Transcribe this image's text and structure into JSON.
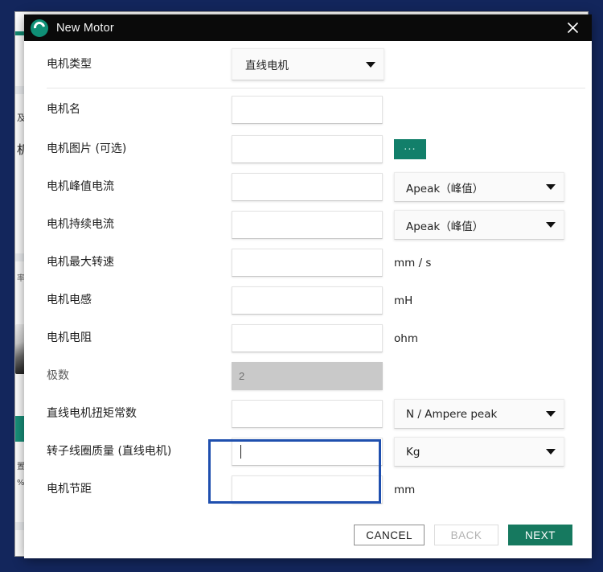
{
  "background_app": {
    "sliver_text_a": "及",
    "sliver_text_b": "机",
    "sliver_text_c": "率",
    "sliver_text_d": "置",
    "sliver_text_e": "%"
  },
  "dialog": {
    "title": "New Motor",
    "logo_icon": "app-logo-icon",
    "close_icon": "close-icon"
  },
  "form": {
    "rows": [
      {
        "label": "电机类型",
        "control": "select",
        "value": "直线电机",
        "trailer": ""
      },
      {
        "label": "电机名",
        "control": "input",
        "value": "",
        "trailer": ""
      },
      {
        "label": "电机图片 (可选)",
        "control": "input",
        "value": "",
        "trailer": "browse",
        "browse_label": "..."
      },
      {
        "label": "电机峰值电流",
        "control": "input",
        "value": "",
        "trailer": "select",
        "trailer_value": "Apeak（峰值）"
      },
      {
        "label": "电机持续电流",
        "control": "input",
        "value": "",
        "trailer": "select",
        "trailer_value": "Apeak（峰值）"
      },
      {
        "label": "电机最大转速",
        "control": "input",
        "value": "",
        "trailer": "unit",
        "trailer_value": "mm / s"
      },
      {
        "label": "电机电感",
        "control": "input",
        "value": "",
        "trailer": "unit",
        "trailer_value": "mH"
      },
      {
        "label": "电机电阻",
        "control": "input",
        "value": "",
        "trailer": "unit",
        "trailer_value": "ohm"
      },
      {
        "label": "极数",
        "control": "input-disabled",
        "value": "2",
        "trailer": ""
      },
      {
        "label": "直线电机扭矩常数",
        "control": "input",
        "value": "",
        "trailer": "select",
        "trailer_value": "N / Ampere peak"
      },
      {
        "label": "转子线圈质量 (直线电机)",
        "control": "input-focused",
        "value": "",
        "trailer": "select",
        "trailer_value": "Kg"
      },
      {
        "label": "电机节距",
        "control": "input",
        "value": "",
        "trailer": "unit",
        "trailer_value": "mm"
      }
    ]
  },
  "footer": {
    "cancel_label": "CANCEL",
    "back_label": "BACK",
    "next_label": "NEXT"
  },
  "colors": {
    "desktop": "#13265c",
    "titlebar": "#0a0a0a",
    "brand_teal": "#16795f",
    "browse_teal": "#127f6a",
    "focus_blue": "#1f4fae"
  }
}
